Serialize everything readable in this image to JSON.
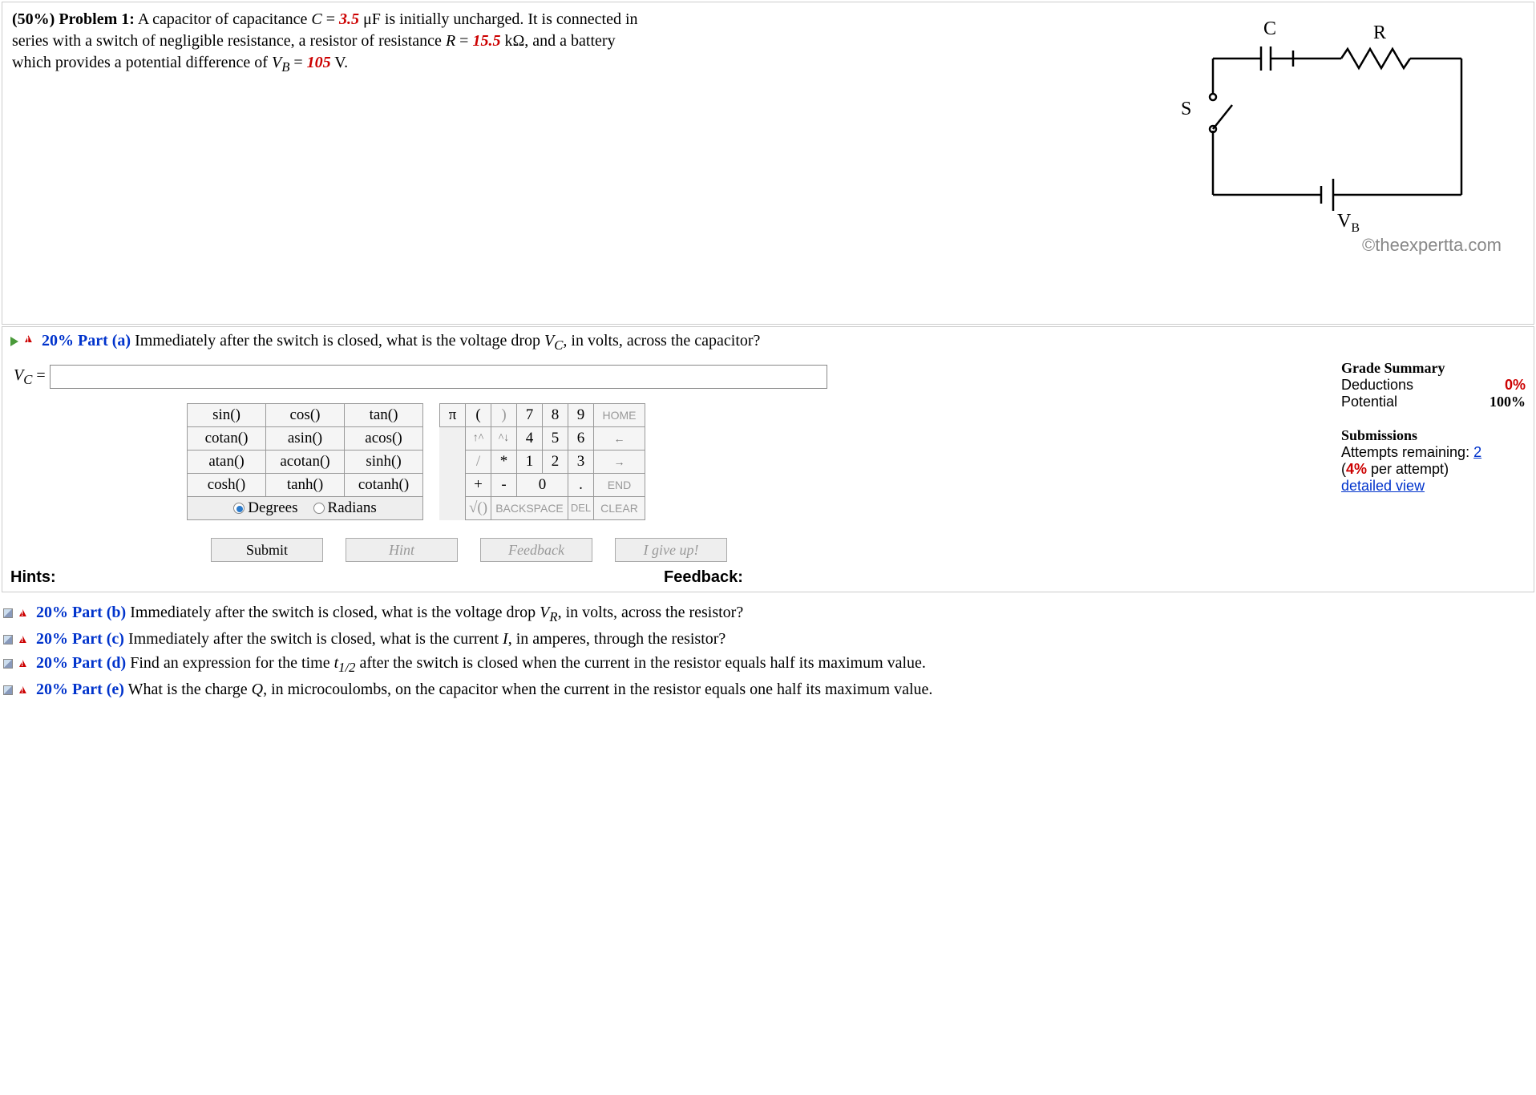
{
  "problem": {
    "header_percent": "(50%)",
    "header_label": "Problem 1:",
    "text_before_c": " A capacitor of capacitance ",
    "c_var": "C",
    "eq": " = ",
    "c_val": "3.5",
    "c_unit": " μF is initially uncharged. It is connected in series with a switch of negligible resistance, a resistor of resistance ",
    "r_var": "R",
    "r_val": "15.5",
    "r_unit": " kΩ, and a battery which provides a potential difference of ",
    "vb_var": "V",
    "vb_sub": "B",
    "vb_val": "105",
    "vb_end": " V."
  },
  "circuit_labels": {
    "C": "C",
    "R": "R",
    "S": "S",
    "VB": "V",
    "VB_sub": "B"
  },
  "copyright": "©theexpertta.com",
  "part_a": {
    "percent": "20%",
    "label": "Part (a)",
    "question": "  Immediately after the switch is closed, what is the voltage drop ",
    "var": "V",
    "var_sub": "C",
    "question_end": ", in volts, across the capacitor?",
    "answer_label_var": "V",
    "answer_label_sub": "C",
    "answer_label_eq": " = "
  },
  "grade": {
    "title": "Grade Summary",
    "deductions_label": "Deductions",
    "deductions_val": "0%",
    "potential_label": "Potential",
    "potential_val": "100%"
  },
  "submissions": {
    "title": "Submissions",
    "attempts_label": "Attempts remaining: ",
    "attempts_val": "2",
    "per_attempt_pre": "(",
    "per_attempt_val": "4%",
    "per_attempt_post": " per attempt)",
    "detailed": "detailed view"
  },
  "funcs": {
    "sin": "sin()",
    "cos": "cos()",
    "tan": "tan()",
    "cotan": "cotan()",
    "asin": "asin()",
    "acos": "acos()",
    "atan": "atan()",
    "acotan": "acotan()",
    "sinh": "sinh()",
    "cosh": "cosh()",
    "tanh": "tanh()",
    "cotanh": "cotanh()",
    "degrees": "Degrees",
    "radians": "Radians"
  },
  "keys": {
    "pi": "π",
    "lp": "(",
    "rp": ")",
    "7": "7",
    "8": "8",
    "9": "9",
    "home": "HOME",
    "up": "↑^",
    "down": "^↓",
    "4": "4",
    "5": "5",
    "6": "6",
    "left": "←",
    "slash": "/",
    "star": "*",
    "1": "1",
    "2": "2",
    "3": "3",
    "right": "→",
    "plus": "+",
    "minus": "-",
    "0": "0",
    "dot": ".",
    "end": "END",
    "sqrt": "√()",
    "backspace": "BACKSPACE",
    "del": "DEL",
    "clear": "CLEAR"
  },
  "actions": {
    "submit": "Submit",
    "hint": "Hint",
    "feedback": "Feedback",
    "giveup": "I give up!"
  },
  "labels": {
    "hints": "Hints:",
    "feedback": "Feedback:"
  },
  "other_parts": {
    "b": {
      "pct": "20%",
      "label": "Part (b)",
      "text": "  Immediately after the switch is closed, what is the voltage drop ",
      "var": "V",
      "sub": "R",
      "end": ", in volts, across the resistor?"
    },
    "c": {
      "pct": "20%",
      "label": "Part (c)",
      "text": "  Immediately after the switch is closed, what is the current ",
      "var": "I",
      "end": ", in amperes, through the resistor?"
    },
    "d": {
      "pct": "20%",
      "label": "Part (d)",
      "text": "  Find an expression for the time ",
      "var": "t",
      "sub": "1/2",
      "end": " after the switch is closed when the current in the resistor equals half its maximum value."
    },
    "e": {
      "pct": "20%",
      "label": "Part (e)",
      "text": "  What is the charge ",
      "var": "Q",
      "end": ", in microcoulombs, on the capacitor when the current in the resistor equals one half its maximum value."
    }
  }
}
